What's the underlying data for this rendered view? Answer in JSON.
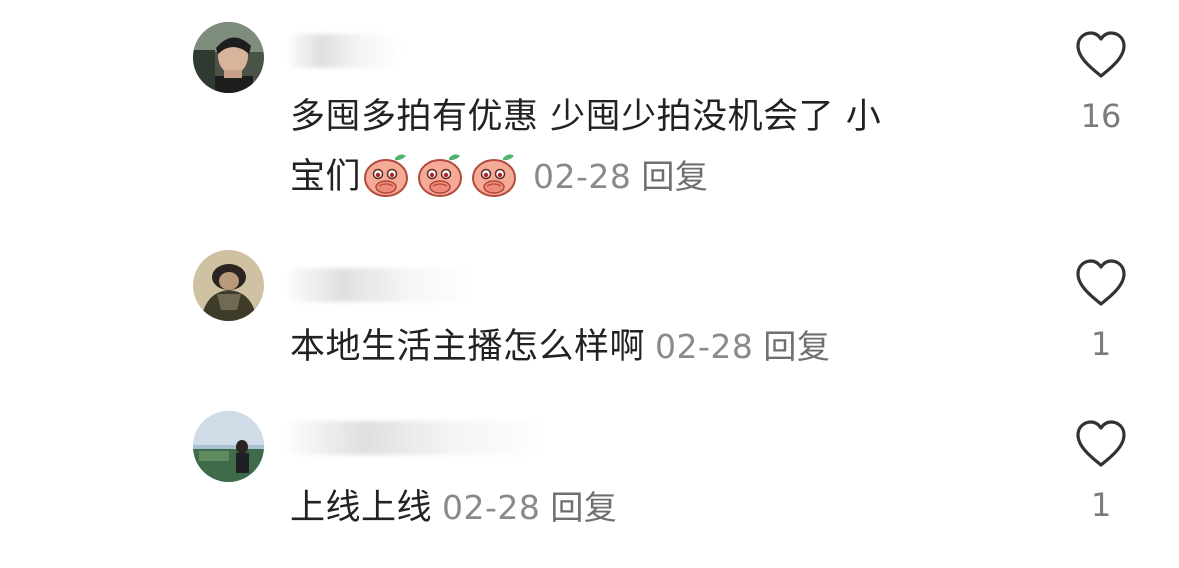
{
  "comments": [
    {
      "text_line1": "多囤多拍有优惠 少囤少拍没机会了 小",
      "text_line2": "宝们",
      "emoji_count": 3,
      "date": "02-28",
      "reply_label": "回复",
      "likes": "16"
    },
    {
      "text": "本地生活主播怎么样啊",
      "date": "02-28",
      "reply_label": "回复",
      "likes": "1"
    },
    {
      "text": "上线上线",
      "date": "02-28",
      "reply_label": "回复",
      "likes": "1"
    }
  ],
  "icons": {
    "like": "heart-outline-icon",
    "emoji": "peach-covering-mouth-emoji"
  },
  "colors": {
    "text": "#222222",
    "meta": "#8a8a8a",
    "icon": "#333333"
  }
}
